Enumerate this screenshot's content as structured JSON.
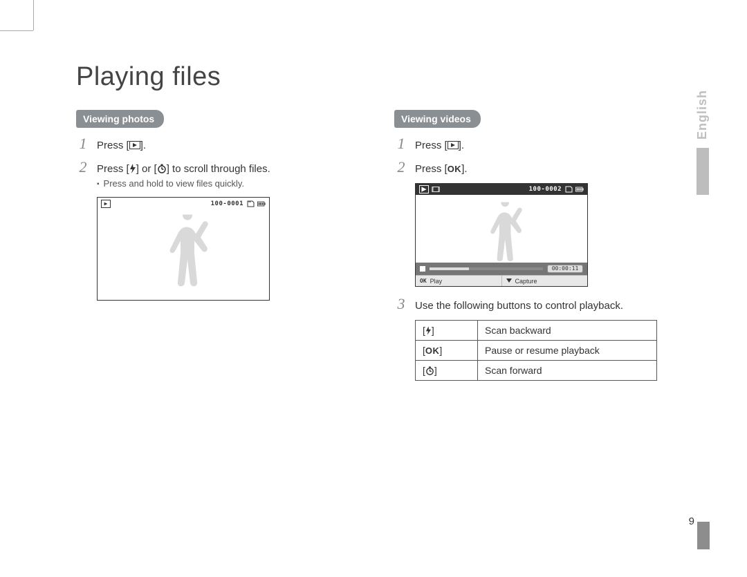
{
  "title": "Playing files",
  "language_tab": "English",
  "page_number": "9",
  "photos": {
    "heading": "Viewing photos",
    "step1_parts": [
      "Press [",
      "]."
    ],
    "step2_parts": [
      "Press [",
      "] or [",
      "] to scroll through files."
    ],
    "sub_note": "Press and hold to view files quickly.",
    "screen": {
      "file_counter": "100-0001"
    }
  },
  "videos": {
    "heading": "Viewing videos",
    "step1_parts": [
      "Press [",
      "]."
    ],
    "step2_parts": [
      "Press [",
      "]."
    ],
    "step2_label": "OK",
    "step3": "Use the following buttons to control playback.",
    "screen": {
      "file_counter": "100-0002",
      "timecode": "00:00:11",
      "play_label": "Play",
      "capture_label": "Capture",
      "ok_label": "OK"
    },
    "controls": {
      "row1_label": "OK",
      "row1_desc": "Scan backward",
      "row2_desc": "Pause or resume playback",
      "row3_desc": "Scan forward"
    }
  }
}
